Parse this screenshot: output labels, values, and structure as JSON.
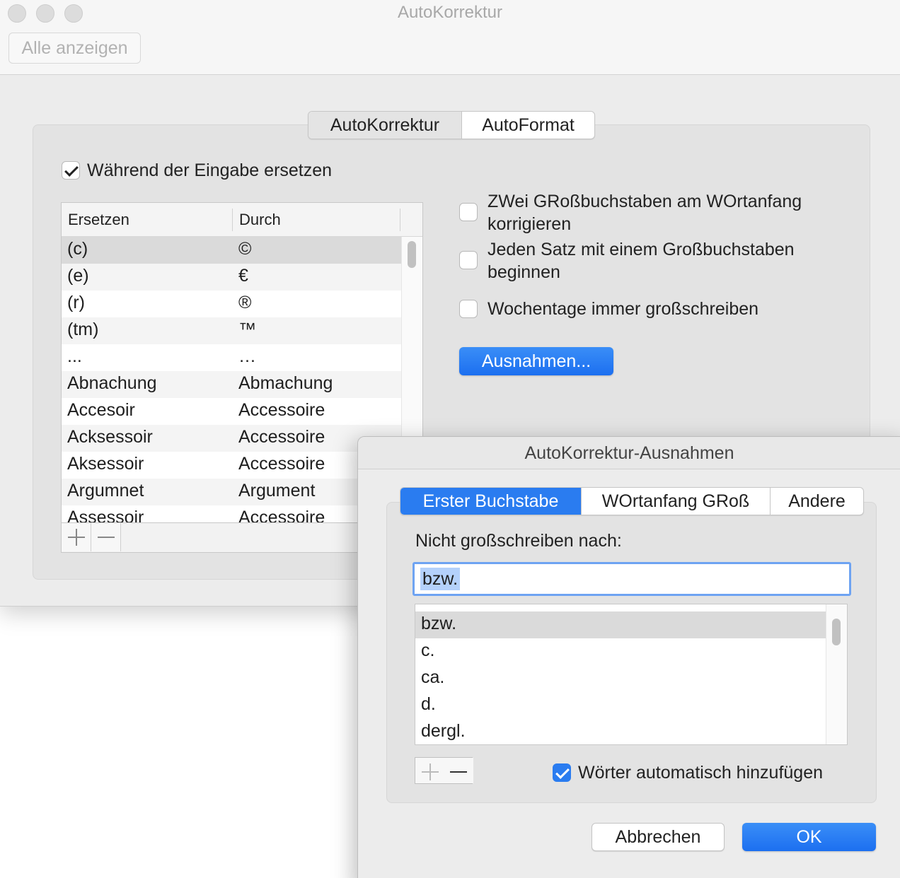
{
  "window": {
    "title": "AutoKorrektur",
    "show_all": "Alle anzeigen"
  },
  "tabs": [
    {
      "label": "AutoKorrektur",
      "selected": true
    },
    {
      "label": "AutoFormat",
      "selected": false
    }
  ],
  "replace_while_typing": {
    "label": "Während der Eingabe ersetzen",
    "checked": true
  },
  "table": {
    "columns": [
      "Ersetzen",
      "Durch"
    ],
    "rows": [
      {
        "replace": "(c)",
        "with": "©"
      },
      {
        "replace": "(e)",
        "with": "€"
      },
      {
        "replace": "(r)",
        "with": "®"
      },
      {
        "replace": "(tm)",
        "with": "™"
      },
      {
        "replace": "...",
        "with": "…"
      },
      {
        "replace": "Abnachung",
        "with": "Abmachung"
      },
      {
        "replace": "Accesoir",
        "with": "Accessoire"
      },
      {
        "replace": "Acksessoir",
        "with": "Accessoire"
      },
      {
        "replace": "Aksessoir",
        "with": "Accessoire"
      },
      {
        "replace": "Argumnet",
        "with": "Argument"
      },
      {
        "replace": "Assessoir",
        "with": "Accessoire"
      }
    ],
    "selected_row": 0
  },
  "options": [
    {
      "line1": "ZWei GRoßbuchstaben am WOrtanfang",
      "line2": "korrigieren",
      "checked": false
    },
    {
      "line1": "Jeden Satz mit einem Großbuchstaben",
      "line2": "beginnen",
      "checked": false
    },
    {
      "line1": "Wochentage immer großschreiben",
      "line2": "",
      "checked": false
    }
  ],
  "exceptions_button": "Ausnahmen...",
  "sheet": {
    "title": "AutoKorrektur-Ausnahmen",
    "tabs": [
      {
        "label": "Erster Buchstabe",
        "selected": true
      },
      {
        "label": "WOrtanfang GRoß",
        "selected": false
      },
      {
        "label": "Andere",
        "selected": false
      }
    ],
    "field_label": "Nicht großschreiben nach:",
    "field_value": "bzw.",
    "list": [
      "bzw.",
      "c.",
      "ca.",
      "d.",
      "dergl."
    ],
    "selected_item": 0,
    "auto_add": {
      "label": "Wörter automatisch hinzufügen",
      "checked": true
    },
    "cancel": "Abbrechen",
    "ok": "OK"
  },
  "colors": {
    "accent": "#2a7cf0",
    "selection": "#dadada",
    "window_bg": "#ececec"
  }
}
